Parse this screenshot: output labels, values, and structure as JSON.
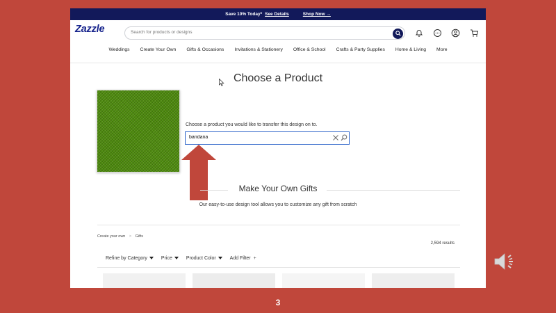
{
  "promo": {
    "offer": "Save 10% Today*",
    "details": "See Details",
    "shop": "Shop Now →"
  },
  "header": {
    "logo": "Zazzle",
    "search_placeholder": "Search for products or designs"
  },
  "icons": [
    "search-icon",
    "bell-icon",
    "chat-icon",
    "account-icon",
    "cart-icon",
    "close-icon",
    "speaker-icon"
  ],
  "nav": [
    "Weddings",
    "Create Your Own",
    "Gifts & Occasions",
    "Invitations & Stationery",
    "Office & School",
    "Crafts & Party Supplies",
    "Home & Living",
    "More"
  ],
  "main": {
    "title": "Choose a Product",
    "prompt": "Choose a product you would like to transfer this design on to.",
    "search_value": "bandana"
  },
  "make_own": {
    "title": "Make Your Own Gifts",
    "subtitle": "Our easy-to-use design tool allows you to customize any gift from scratch"
  },
  "breadcrumb": {
    "parent": "Create your own",
    "sep": ">",
    "current": "Gifts"
  },
  "results": "2,594 results",
  "filters": [
    "Refine by Category",
    "Price",
    "Product Color",
    "Add Filter"
  ],
  "add_filter_icon": "+",
  "slide": {
    "page_number": "3"
  },
  "colors": {
    "navy": "#12195a",
    "logo": "#16238c",
    "slide_bg": "#c0473b",
    "arrow": "#c0473b",
    "focus": "#2a62c8"
  }
}
